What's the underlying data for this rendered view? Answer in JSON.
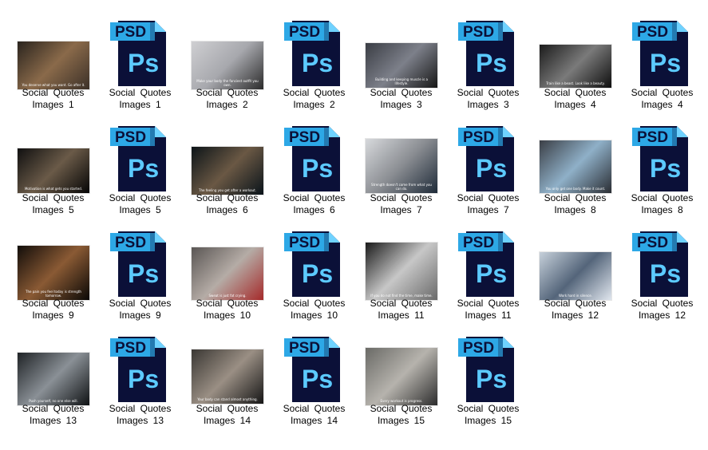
{
  "window": {
    "view": "large-icons"
  },
  "files": [
    {
      "label": "Social  Quotes Images 1",
      "type": "image",
      "palette": [
        "#2a241e",
        "#8a6a4a",
        "#3b3028"
      ]
    },
    {
      "label": "Social  Quotes Images 1",
      "type": "psd"
    },
    {
      "label": "Social  Quotes Images 2",
      "type": "image",
      "palette": [
        "#cfcfd2",
        "#a7a8ad",
        "#2b2b2b"
      ]
    },
    {
      "label": "Social  Quotes Images 2",
      "type": "psd"
    },
    {
      "label": "Social  Quotes Images 3",
      "type": "image",
      "palette": [
        "#3a3d44",
        "#7d808a",
        "#161616"
      ]
    },
    {
      "label": "Social  Quotes Images 3",
      "type": "psd"
    },
    {
      "label": "Social  Quotes Images 4",
      "type": "image",
      "palette": [
        "#1b1b1b",
        "#7a7a7a",
        "#0e0e0e"
      ]
    },
    {
      "label": "Social  Quotes Images 4",
      "type": "psd"
    },
    {
      "label": "Social  Quotes Images 5",
      "type": "image",
      "palette": [
        "#101010",
        "#6a5a48",
        "#050505"
      ]
    },
    {
      "label": "Social  Quotes Images 5",
      "type": "psd"
    },
    {
      "label": "Social  Quotes Images 6",
      "type": "image",
      "palette": [
        "#0c1418",
        "#6a5844",
        "#09131a"
      ]
    },
    {
      "label": "Social  Quotes Images 6",
      "type": "psd"
    },
    {
      "label": "Social  Quotes Images 7",
      "type": "image",
      "palette": [
        "#d7d9dc",
        "#8a8d92",
        "#1e2a38"
      ]
    },
    {
      "label": "Social  Quotes Images 7",
      "type": "psd"
    },
    {
      "label": "Social  Quotes Images 8",
      "type": "image",
      "palette": [
        "#3b3f46",
        "#8fb0c8",
        "#2a2d33"
      ]
    },
    {
      "label": "Social  Quotes Images 8",
      "type": "psd"
    },
    {
      "label": "Social  Quotes Images 9",
      "type": "image",
      "palette": [
        "#120d0a",
        "#8a5a34",
        "#0a0806"
      ]
    },
    {
      "label": "Social  Quotes Images 9",
      "type": "psd"
    },
    {
      "label": "Social  Quotes Images 10",
      "type": "image",
      "palette": [
        "#5a5654",
        "#b5aca6",
        "#a52a2a"
      ]
    },
    {
      "label": "Social  Quotes Images 10",
      "type": "psd"
    },
    {
      "label": "Social  Quotes Images 11",
      "type": "image",
      "palette": [
        "#1a1a1a",
        "#c7c7c7",
        "#6a6a6a"
      ]
    },
    {
      "label": "Social  Quotes Images 11",
      "type": "psd"
    },
    {
      "label": "Social  Quotes Images 12",
      "type": "image",
      "palette": [
        "#c6d0da",
        "#54657a",
        "#e0e6ee"
      ]
    },
    {
      "label": "Social  Quotes Images 12",
      "type": "psd"
    },
    {
      "label": "Social  Quotes Images 13",
      "type": "image",
      "palette": [
        "#1f2326",
        "#8a9096",
        "#0f1214"
      ]
    },
    {
      "label": "Social  Quotes Images 13",
      "type": "psd"
    },
    {
      "label": "Social  Quotes Images 14",
      "type": "image",
      "palette": [
        "#3a3733",
        "#9a8f84",
        "#151515"
      ]
    },
    {
      "label": "Social  Quotes Images 14",
      "type": "psd"
    },
    {
      "label": "Social  Quotes Images 15",
      "type": "image",
      "palette": [
        "#6a6a66",
        "#b6b3ad",
        "#2c2c2c"
      ]
    },
    {
      "label": "Social  Quotes Images 15",
      "type": "psd"
    }
  ],
  "psd_icon": {
    "badge_text": "PSD",
    "app_text": "Ps",
    "colors": {
      "body": "#0b1038",
      "badge": "#2da8e6",
      "fold": "#6fd2ff",
      "text": "#5ccaff"
    }
  },
  "thumb_captions": [
    "You deserve what you want. Go after it.",
    "Make your body the fanciest outfit you own.",
    "Building and keeping muscle is a lifestyle.",
    "Train like a beast. Look like a beauty.",
    "Motivation is what gets you started.",
    "The feeling you get after a workout.",
    "Strength doesn't come from what you can do.",
    "You only get one body. Make it count.",
    "The pain you feel today is strength tomorrow.",
    "Sweat is just fat crying.",
    "If you do not find the time, make time.",
    "Work hard in silence.",
    "Push yourself, no one else will.",
    "Your body can stand almost anything.",
    "Every workout is progress."
  ]
}
